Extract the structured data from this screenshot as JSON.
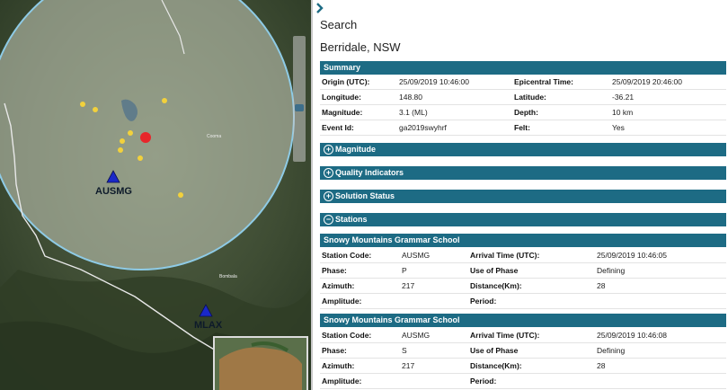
{
  "map": {
    "stations": [
      {
        "label": "AUSMG"
      },
      {
        "label": "MLAX"
      }
    ],
    "place_labels": [
      "Cooma",
      "Bombala"
    ]
  },
  "panel": {
    "collapse_icon": "chevron-right",
    "title": "Search",
    "location": "Berridale, NSW"
  },
  "summary": {
    "header": "Summary",
    "rows": [
      {
        "l1": "Origin (UTC):",
        "v1": "25/09/2019 10:46:00",
        "l2": "Epicentral Time:",
        "v2": "25/09/2019 20:46:00"
      },
      {
        "l1": "Longitude:",
        "v1": "148.80",
        "l2": "Latitude:",
        "v2": "-36.21"
      },
      {
        "l1": "Magnitude:",
        "v1": "3.1 (ML)",
        "l2": "Depth:",
        "v2": "10 km"
      },
      {
        "l1": "Event Id:",
        "v1": "ga2019swyhrf",
        "l2": "Felt:",
        "v2": "Yes"
      }
    ]
  },
  "sections": [
    {
      "label": "Magnitude",
      "sign": "+"
    },
    {
      "label": "Quality Indicators",
      "sign": "+"
    },
    {
      "label": "Solution Status",
      "sign": "+"
    },
    {
      "label": "Stations",
      "sign": "−"
    }
  ],
  "stations": [
    {
      "header": "Snowy Mountains Grammar School",
      "rows": [
        {
          "l1": "Station Code:",
          "v1": "AUSMG",
          "l2": "Arrival Time (UTC):",
          "v2": "25/09/2019 10:46:05"
        },
        {
          "l1": "Phase:",
          "v1": "P",
          "l2": "Use of Phase",
          "v2": "Defining"
        },
        {
          "l1": "Azimuth:",
          "v1": "217",
          "l2": "Distance(Km):",
          "v2": "28"
        },
        {
          "l1": "Amplitude:",
          "v1": "",
          "l2": "Period:",
          "v2": ""
        }
      ]
    },
    {
      "header": "Snowy Mountains Grammar School",
      "rows": [
        {
          "l1": "Station Code:",
          "v1": "AUSMG",
          "l2": "Arrival Time (UTC):",
          "v2": "25/09/2019 10:46:08"
        },
        {
          "l1": "Phase:",
          "v1": "S",
          "l2": "Use of Phase",
          "v2": "Defining"
        },
        {
          "l1": "Azimuth:",
          "v1": "217",
          "l2": "Distance(Km):",
          "v2": "28"
        },
        {
          "l1": "Amplitude:",
          "v1": "",
          "l2": "Period:",
          "v2": ""
        }
      ]
    }
  ],
  "colors": {
    "accent": "#1d6b84",
    "epicenter": "#e8262b",
    "event_dot": "#f2d13c",
    "station": "#1a28c8"
  }
}
